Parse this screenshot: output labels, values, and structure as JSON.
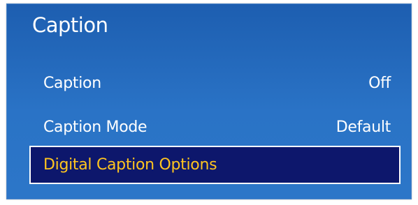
{
  "menu": {
    "title": "Caption",
    "items": [
      {
        "label": "Caption",
        "value": "Off"
      },
      {
        "label": "Caption Mode",
        "value": "Default"
      },
      {
        "label": "Digital Caption Options",
        "value": ""
      }
    ],
    "selected_index": 2
  },
  "colors": {
    "panel_blue": "#2a70c2",
    "selected_background": "#0d176c",
    "selected_text": "#ffc51f",
    "text": "#ffffff"
  }
}
